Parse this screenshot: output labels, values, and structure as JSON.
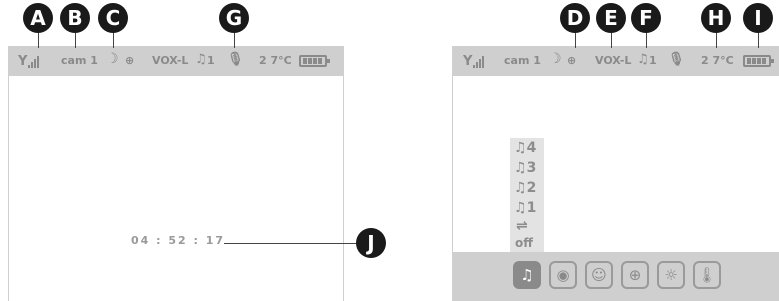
{
  "callouts": {
    "a": "A",
    "b": "B",
    "c": "C",
    "d": "D",
    "e": "E",
    "f": "F",
    "g": "G",
    "h": "H",
    "i": "I",
    "j": "J"
  },
  "left_screen": {
    "status": {
      "camera": "cam 1",
      "night_icon": "moon-icon",
      "zoom_icon": "zoom-icon",
      "vox": "VOX-L",
      "music_icon": "music-note-icon",
      "music_track": "1",
      "mic_icon": "microphone-icon",
      "temperature": "2 7°C",
      "signal_icon": "signal-icon",
      "battery_icon": "battery-icon"
    },
    "timer": "04 : 52 : 17"
  },
  "right_screen": {
    "status": {
      "camera": "cam 1",
      "vox": "VOX-L",
      "music_track": "1",
      "temperature": "2 7°C"
    },
    "music_menu": {
      "items": [
        "4",
        "3",
        "2",
        "1"
      ],
      "repeat_icon": "repeat-icon",
      "off_label": "off"
    },
    "toolbar": {
      "buttons": [
        "music-icon",
        "camera-icon",
        "lullaby-face-icon",
        "zoom-icon",
        "brightness-icon",
        "thermometer-icon"
      ],
      "active": "music-icon"
    }
  },
  "colors": {
    "status_bar": "#cfcfcf",
    "icon_gray": "#8a8a8a",
    "callout": "#1a1a1a"
  }
}
